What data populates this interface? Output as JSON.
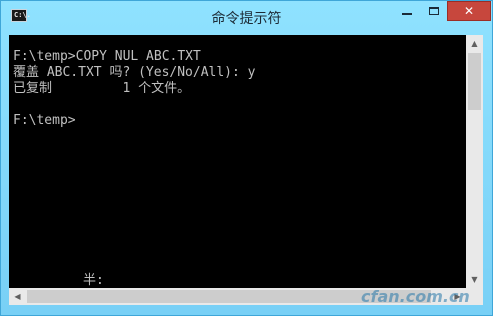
{
  "window": {
    "title": "命令提示符",
    "icon_label": "C:\\.",
    "minimize_icon": "minimize-icon",
    "maximize_icon": "maximize-icon",
    "close_label": "✕"
  },
  "console": {
    "lines": [
      "F:\\temp>COPY NUL ABC.TXT",
      "覆盖 ABC.TXT 吗? (Yes/No/All): y",
      "已复制         1 个文件。",
      "",
      "F:\\temp>"
    ],
    "ime_status": "半:"
  },
  "watermark": "cfan.com.cn",
  "colors": {
    "titlebar": "#8fe2ff",
    "console_bg": "#000000",
    "console_text": "#c0c0c0",
    "close_button": "#c7473d"
  }
}
